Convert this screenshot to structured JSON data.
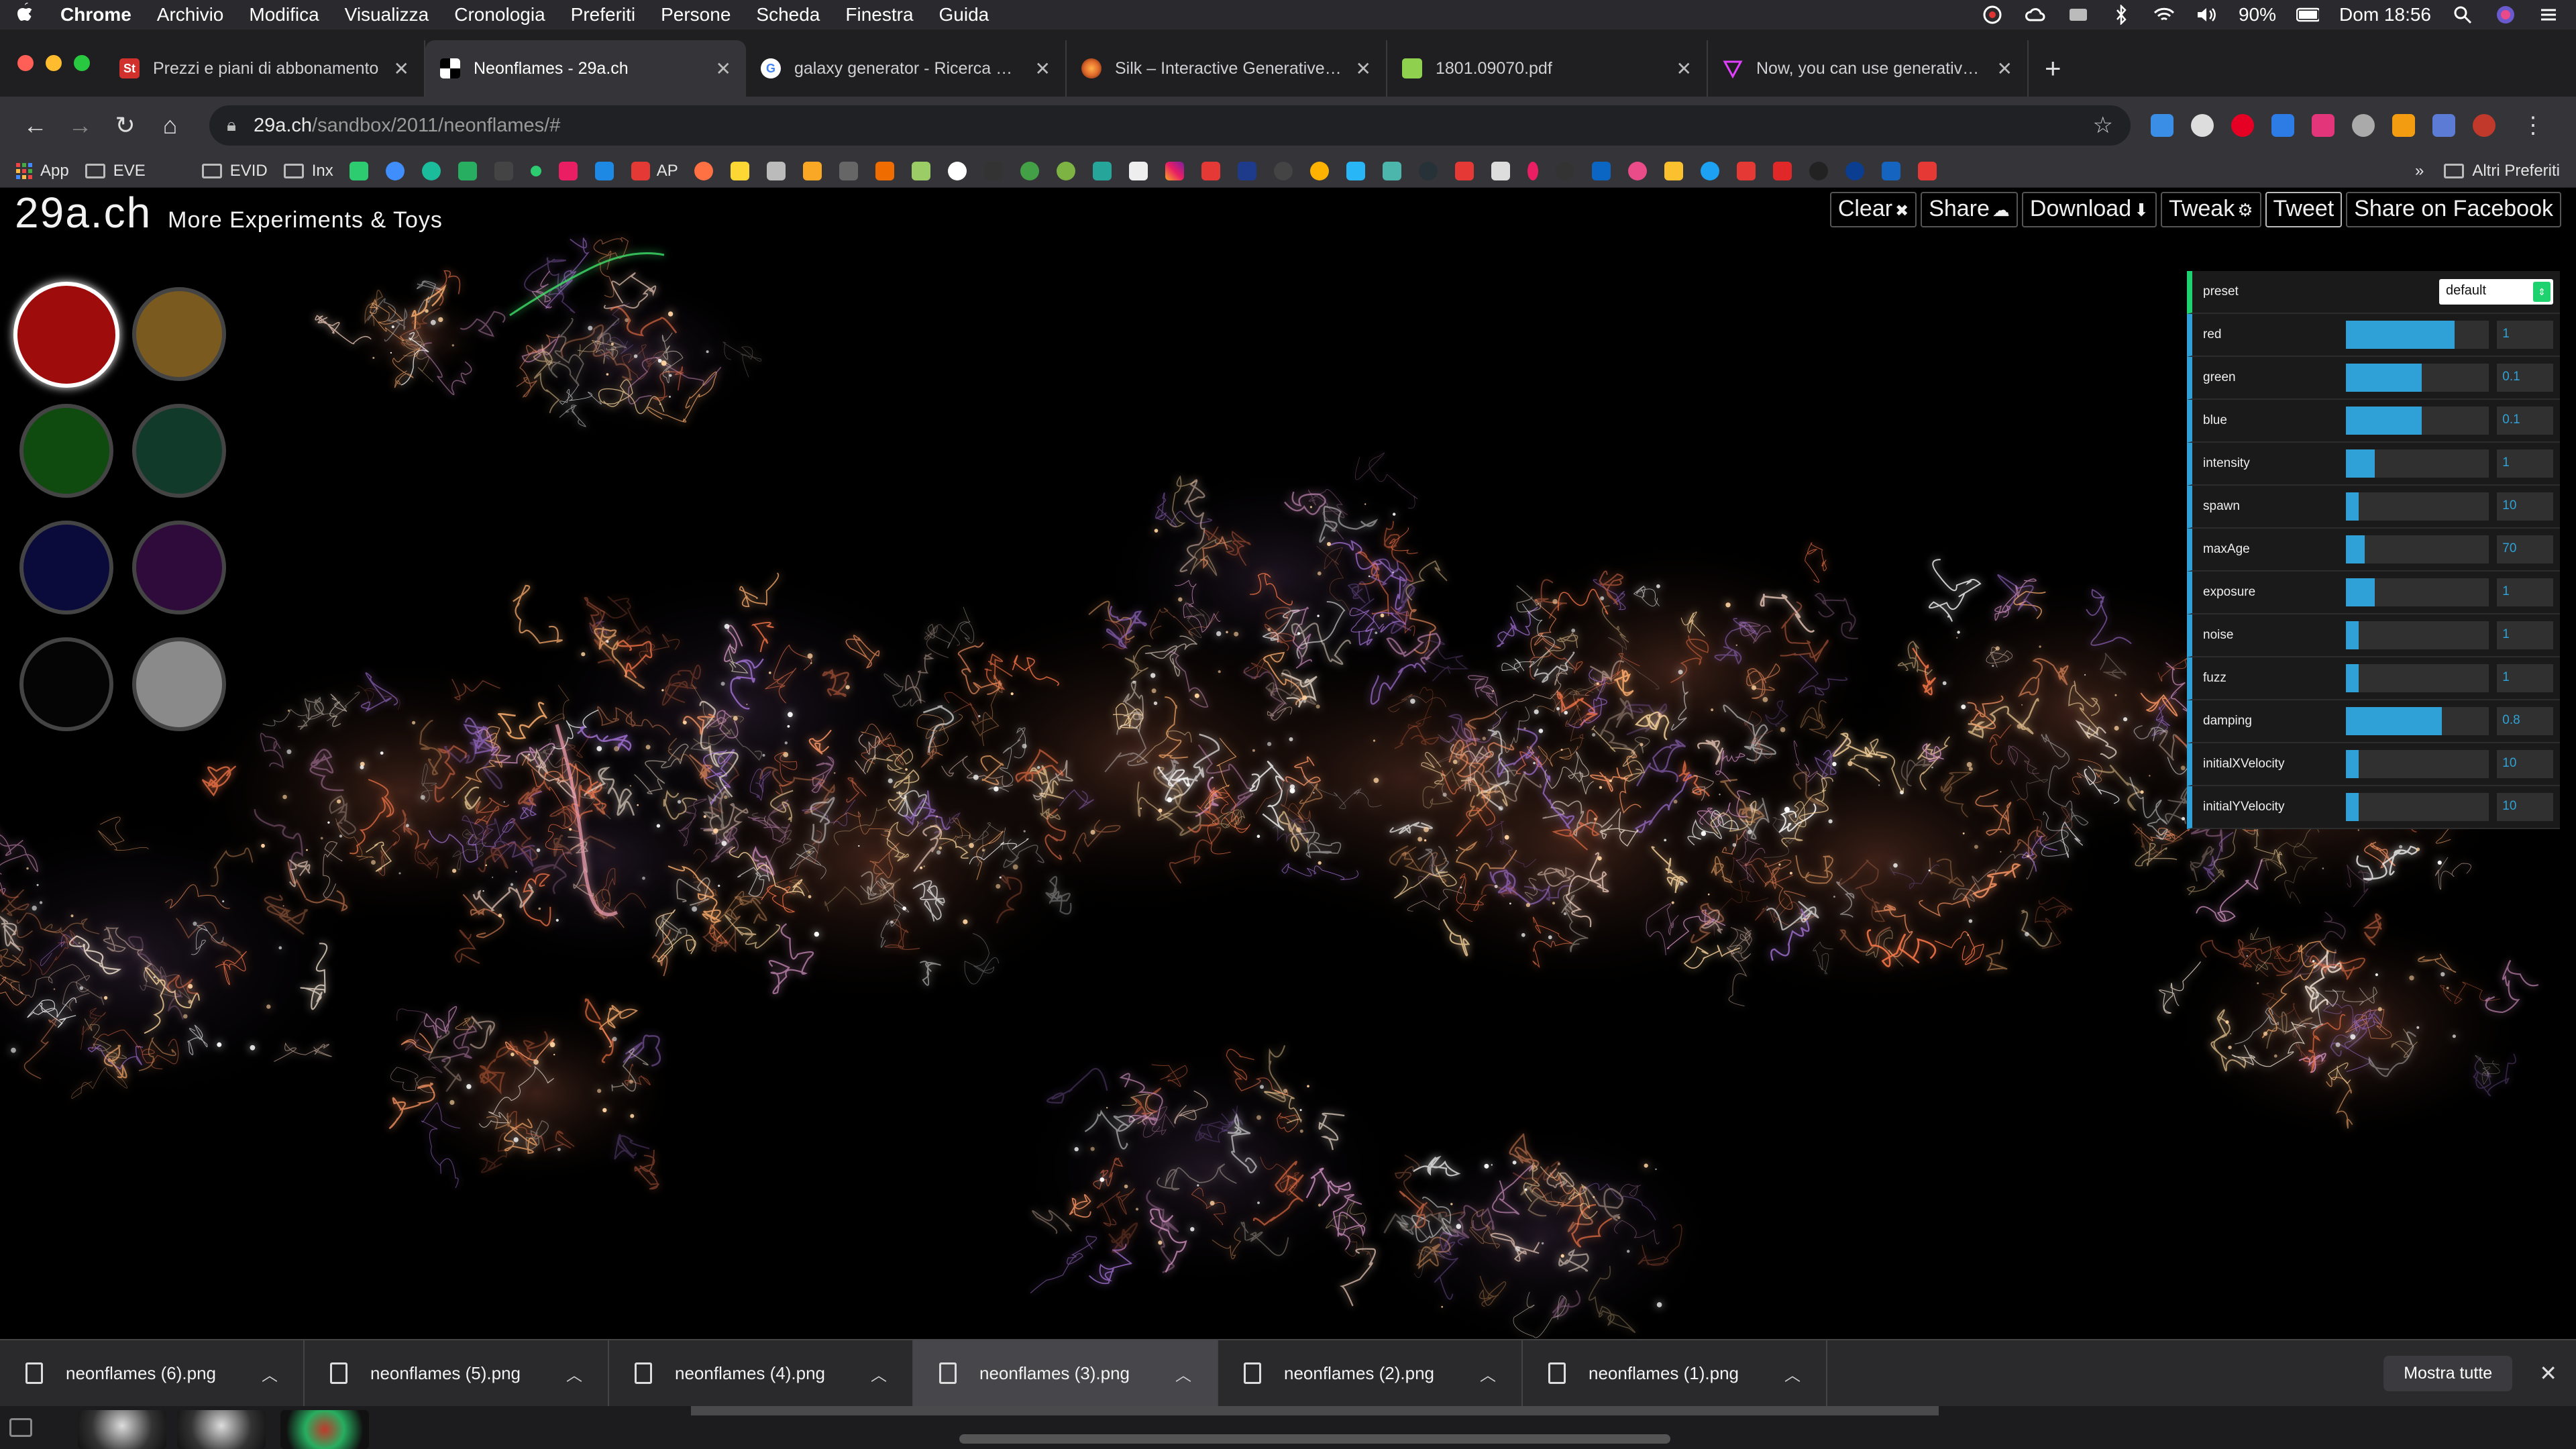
{
  "menubar": {
    "apple": "",
    "items": [
      "Chrome",
      "Archivio",
      "Modifica",
      "Visualizza",
      "Cronologia",
      "Preferiti",
      "Persone",
      "Scheda",
      "Finestra",
      "Guida"
    ],
    "battery": "90%",
    "clock": "Dom 18:56"
  },
  "tabs": [
    {
      "title": "Prezzi e piani di abbonamento",
      "favicon_color": "#d0312d",
      "favicon_text": "St"
    },
    {
      "title": "Neonflames - 29a.ch",
      "favicon_color": "#ffffff",
      "favicon_text": ""
    },
    {
      "title": "galaxy generator - Ricerca Goo",
      "favicon_color": "#ffffff",
      "favicon_text": "G"
    },
    {
      "title": "Silk – Interactive Generative Ar",
      "favicon_color": "#e06a2b",
      "favicon_text": ""
    },
    {
      "title": "1801.09070.pdf",
      "favicon_color": "#8fd14f",
      "favicon_text": ""
    },
    {
      "title": "Now, you can use generative p",
      "favicon_color": "#b93adb",
      "favicon_text": ""
    }
  ],
  "omnibox": {
    "host": "29a.ch",
    "path": "/sandbox/2011/neonflames/#"
  },
  "bookmarks": {
    "apps_label": "App",
    "folders": [
      "EVE",
      "EVID",
      "Inx"
    ],
    "ap_label": "AP",
    "more": "Altri Preferiti",
    "chevron": "»"
  },
  "page": {
    "brand": "29a.ch",
    "subtitle": "More Experiments & Toys",
    "actions": [
      "Clear",
      "Share",
      "Download",
      "Tweak",
      "Tweet",
      "Share on Facebook"
    ],
    "action_icons": [
      "✖",
      "☁",
      "⬇",
      "⚙",
      "",
      ""
    ],
    "swatches": [
      {
        "color": "#9e0c0c",
        "selected": true
      },
      {
        "color": "#7a5a1e",
        "selected": false
      },
      {
        "color": "#0f4a0f",
        "selected": false
      },
      {
        "color": "#123a2a",
        "selected": false
      },
      {
        "color": "#0b0b3b",
        "selected": false
      },
      {
        "color": "#2e0b3a",
        "selected": false
      },
      {
        "color": "#050505",
        "selected": false
      },
      {
        "color": "#8a8a8a",
        "selected": false
      }
    ]
  },
  "gui": {
    "preset_label": "preset",
    "preset_value": "default",
    "controls": [
      {
        "label": "red",
        "value": "1",
        "fill": 0.76
      },
      {
        "label": "green",
        "value": "0.1",
        "fill": 0.53
      },
      {
        "label": "blue",
        "value": "0.1",
        "fill": 0.53
      },
      {
        "label": "intensity",
        "value": "1",
        "fill": 0.2
      },
      {
        "label": "spawn",
        "value": "10",
        "fill": 0.09
      },
      {
        "label": "maxAge",
        "value": "70",
        "fill": 0.13
      },
      {
        "label": "exposure",
        "value": "1",
        "fill": 0.2
      },
      {
        "label": "noise",
        "value": "1",
        "fill": 0.09
      },
      {
        "label": "fuzz",
        "value": "1",
        "fill": 0.09
      },
      {
        "label": "damping",
        "value": "0.8",
        "fill": 0.67
      },
      {
        "label": "initialXVelocity",
        "value": "10",
        "fill": 0.09
      },
      {
        "label": "initialYVelocity",
        "value": "10",
        "fill": 0.09
      }
    ]
  },
  "downloads": {
    "files": [
      "neonflames (6).png",
      "neonflames (5).png",
      "neonflames (4).png",
      "neonflames (3).png",
      "neonflames (2).png",
      "neonflames (1).png"
    ],
    "active_index": 3,
    "show_all": "Mostra tutte",
    "close": "✕"
  },
  "colors": {
    "gui_accent": "#2fa1d6",
    "preset_accent": "#1ed36f"
  }
}
